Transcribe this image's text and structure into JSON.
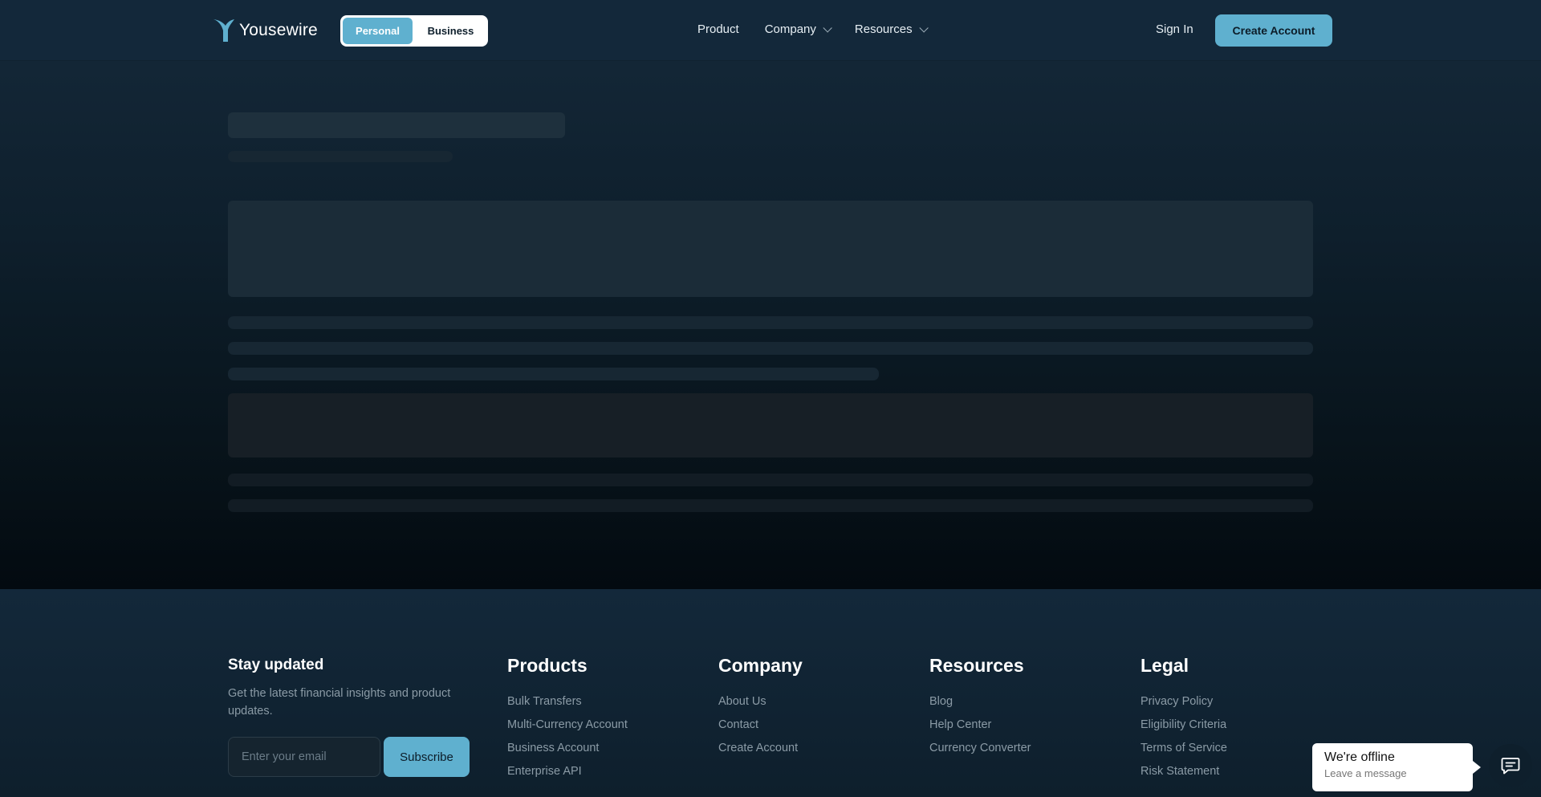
{
  "header": {
    "brand": "Yousewire",
    "segment": {
      "personal": "Personal",
      "business": "Business",
      "active": "personal"
    },
    "nav": {
      "product": "Product",
      "company": "Company",
      "resources": "Resources"
    },
    "sign_in": "Sign In",
    "create_account": "Create Account"
  },
  "colors": {
    "accent": "#5fb0cf",
    "header_bg": "#13283a",
    "page_bg": "#030a10"
  },
  "footer": {
    "newsletter": {
      "title": "Stay updated",
      "description": "Get the latest financial insights and product updates.",
      "email_placeholder": "Enter your email",
      "subscribe": "Subscribe"
    },
    "columns": [
      {
        "title": "Products",
        "links": [
          "Bulk Transfers",
          "Multi-Currency Account",
          "Business Account",
          "Enterprise API"
        ]
      },
      {
        "title": "Company",
        "links": [
          "About Us",
          "Contact",
          "Create Account"
        ]
      },
      {
        "title": "Resources",
        "links": [
          "Blog",
          "Help Center",
          "Currency Converter"
        ]
      },
      {
        "title": "Legal",
        "links": [
          "Privacy Policy",
          "Eligibility Criteria",
          "Terms of Service",
          "Risk Statement"
        ]
      }
    ]
  },
  "chat": {
    "title": "We're offline",
    "subtitle": "Leave a message",
    "icon": "chat-bubble-icon"
  }
}
